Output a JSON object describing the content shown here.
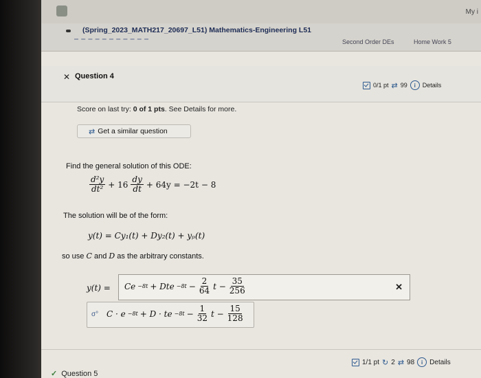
{
  "topbar": {
    "user_text": "My i"
  },
  "course": {
    "title": "(Spring_2023_MATH217_20697_L51) Mathematics-Engineering L51",
    "crumb_1": "Second Order DEs",
    "crumb_2": "Home Work 5"
  },
  "question": {
    "title": "Question 4",
    "points": "0/1 pt",
    "retries": "99",
    "details": "Details",
    "score_prefix": "Score on last try: ",
    "score_value": "0 of 1 pts",
    "score_suffix": ". See Details for more.",
    "similar_label": "Get a similar question",
    "prompt": "Find the general solution of this ODE:",
    "form_intro": "The solution will be of the form:",
    "arb_prefix": "so use",
    "arb_c": "C",
    "arb_and": "and",
    "arb_d": "D",
    "arb_suffix": "as the arbitrary constants."
  },
  "ode": {
    "d2": "d²y",
    "dt2": "dt²",
    "plus16": "+ 16",
    "dy": "dy",
    "dt": "dt",
    "rest": "+ 64y = −2t − 8"
  },
  "form_equation": "y(t) = Cy₁(t) + Dy₂(t) + yₚ(t)",
  "answer": {
    "label": "y(t) =",
    "c_term": "Ce",
    "exp": "−8t",
    "d_term": "+ Dte",
    "minus1": "−",
    "f1_num": "2",
    "f1_den": "64",
    "t_minus": "t −",
    "f2_num": "35",
    "f2_den": "256",
    "clear_icon": "✕"
  },
  "preview": {
    "c_term": "C · e",
    "exp": "−8t",
    "d_term": "+ D · te",
    "minus1": "−",
    "f1_num": "1",
    "f1_den": "32",
    "t_minus": "t −",
    "f2_num": "15",
    "f2_den": "128"
  },
  "next_question": {
    "title": "Question 5",
    "points": "1/1 pt",
    "attempts": "2",
    "retries": "98",
    "details": "Details"
  },
  "icons": {
    "check_box": "check-box-icon",
    "retry": "retry-icon",
    "info": "info-icon"
  }
}
